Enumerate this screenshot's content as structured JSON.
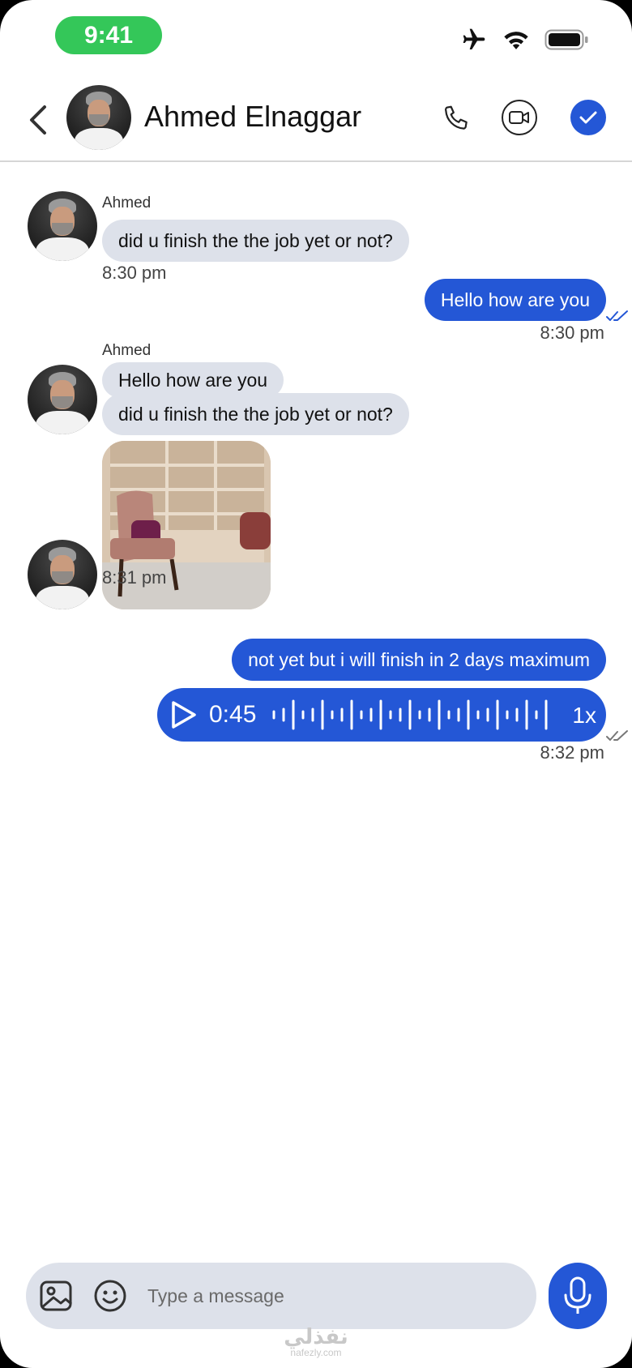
{
  "status_bar": {
    "time": "9:41"
  },
  "header": {
    "contact_name": "Ahmed Elnaggar"
  },
  "messages": {
    "m1": {
      "sender": "Ahmed",
      "text": "did u finish the the job yet or not?",
      "time": "8:30 pm"
    },
    "m2": {
      "text": "Hello how are you",
      "time": "8:30 pm"
    },
    "m3": {
      "sender": "Ahmed",
      "text_a": "Hello how are you",
      "text_b": "did u finish the the job yet or not?",
      "time": "8:31 pm"
    },
    "m4": {
      "text": "not yet but i will finish in 2 days maximum"
    },
    "m5": {
      "duration": "0:45",
      "speed": "1x",
      "time": "8:32 pm"
    }
  },
  "composer": {
    "placeholder": "Type a message"
  },
  "watermark": {
    "text_ar": "نفذلي",
    "text_en": "nafezly.com"
  },
  "colors": {
    "accent": "#2457d6",
    "incoming_bubble": "#dde1ea",
    "status_pill": "#34c759"
  }
}
